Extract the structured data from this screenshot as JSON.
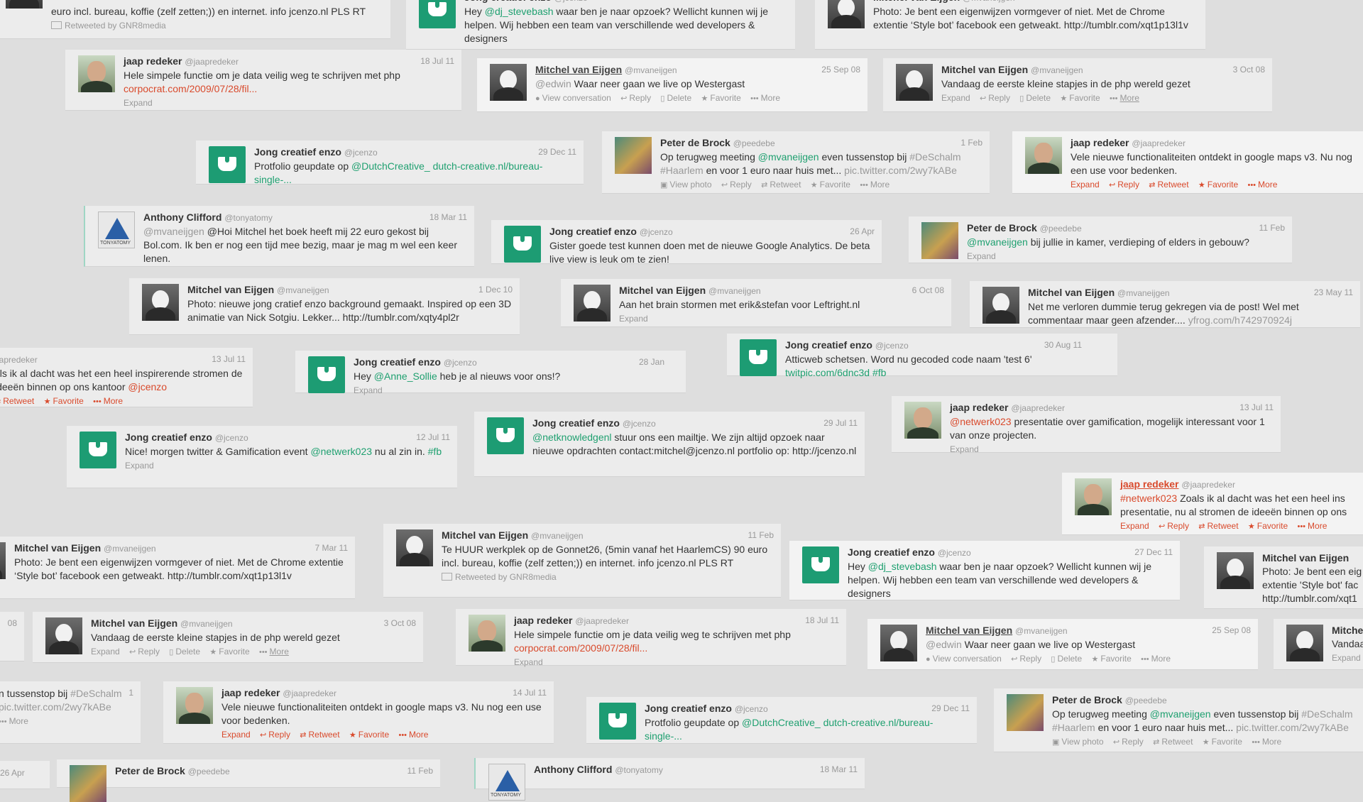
{
  "screen": {
    "background": "#dedede",
    "card_background": "#ececec",
    "accent_green": "#1fa070",
    "accent_red": "#d94a2c"
  },
  "users": {
    "jcenzo": {
      "name": "Jong creatief enzo",
      "handle": "@jcenzo"
    },
    "mvaneijgen": {
      "name": "Mitchel van Eijgen",
      "handle": "@mvaneijgen"
    },
    "jaapredeker": {
      "name": "jaap redeker",
      "handle": "@jaapredeker"
    },
    "peedebe": {
      "name": "Peter de Brock",
      "handle": "@peedebe"
    },
    "tonyatomy": {
      "name": "Anthony Clifford",
      "handle": "@tonyatomy"
    }
  },
  "labels": {
    "expand": "Expand",
    "reply": "Reply",
    "retweet": "Retweet",
    "favorite": "Favorite",
    "more": "More",
    "delete": "Delete",
    "view_photo": "View photo",
    "view_conversation": "View conversation",
    "retweeted_by": "Retweeted by GNR8media"
  },
  "text": {
    "werkplek": "Te HUUR werkplek op de Gonnet26, (5min vanaf het HaarlemCS) 90 euro incl. bureau, koffie (zelf zetten;)) en internet. info jcenzo.nl PLS RT",
    "werkplek_tail": "euro incl. bureau, koffie (zelf zetten;)) en internet. info jcenzo.nl PLS RT",
    "hey_pre": "Hey ",
    "stevebash": "@dj_stevebash",
    "hey_post": " waar ben je naar opzoek? Wellicht kunnen wij je helpen. Wij hebben een team van verschillende wed developers & designers",
    "photo_style": "Photo: Je bent een eigenwijzen vormgever of niet. Met de Chrome extentie ‘Style bot’ facebook een getweakt. http://tumblr.com/xqt1p13l1v",
    "php_func": "Hele simpele functie om je data veilig weg te schrijven met php ",
    "php_url": "corpocrat.com/2009/07/28/fil...",
    "edwin_mention": "@edwin",
    "edwin_post": " Waar neer gaan we live op Westergast",
    "php_steps": "Vandaag de eerste kleine stapjes in de php wereld gezet",
    "portfolio_pre": "Protfolio geupdate op ",
    "portfolio_mention": "@DutchCreative_ dutch-creative.nl/bureau-single-...",
    "meeting_pre": "Op terugweg meeting ",
    "meeting_mention": "@mvaneijgen",
    "meeting_mid": " even tussenstop bij ",
    "meeting_tag": "#DeSchalm #Haarlem",
    "meeting_post": " en voor 1 euro naar huis met... ",
    "meeting_pic": "pic.twitter.com/2wy7kABe",
    "maps": "Vele nieuwe functionaliteiten ontdekt in google maps v3. Nu nog een use voor bedenken.",
    "boek_mention": "@mvaneijgen",
    "boek_mid": " @Hoi Mitchel het boek heeft mij 22 euro gekost bij Bol.com. Ik ben er nog een tijd mee bezig, maar je mag m wel een keer lenen.",
    "analytics": "Gister goede test kunnen doen met de nieuwe Google Analytics. De beta live view is leuk om te zien!",
    "kamer_mention": "@mvaneijgen",
    "kamer_post": " bij jullie in kamer, verdieping of elders in gebouw?",
    "background_photo": "Photo: nieuwe jong cratief enzo background gemaakt. Inspired op een 3D animatie van Nick Sotgiu. Lekker... http://tumblr.com/xqty4pl2r",
    "brainstorm": "Aan het brain stormen met erik&stefan voor Leftright.nl",
    "dummie_pre": "Net me verloren dummie terug gekregen via de post! Wel met commentaar maar geen afzender.... ",
    "dummie_url": "yfrog.com/h742970924j",
    "atticweb": "Atticweb schetsen. Word nu gecoded code naam 'test 6' ",
    "atticweb_link": "twitpic.com/6dnc3d #fb",
    "inspirerend_pre": "Zoals ik al dacht was het een heel inspirerende presentatie, nu al stromen de ideeën binnen op ons kantoor ",
    "inspirerend_short_pre": "als ik al dacht was het een heel inspirerende stromen de ideeën binnen op ons kantoor ",
    "inspirerend_mention": "@jcenzo",
    "sollie_pre": "Hey ",
    "sollie_mention": "@Anne_Sollie",
    "sollie_post": " heb je al nieuws voor ons!?",
    "mailtje_mention": "@netknowledgenl",
    "mailtje_post": " stuur ons een mailtje. We zijn altijd opzoek naar nieuwe opdrachten contact:mitchel@jcenzo.nl portfolio op: http://jcenzo.nl",
    "gamification_mention": "@netwerk023",
    "gamification_post": " presentatie over gamification, mogelijk interessant voor 1 van onze projecten.",
    "nice_pre": "Nice! morgen twitter & Gamification event ",
    "nice_mention": "@netwerk023",
    "nice_mid": " nu al zin in. ",
    "nice_tag": "#fb",
    "netwerk_mention": "#netwerk023",
    "inspirerend_frag": "Zoals ik al dacht was het een heel ins presentatie, nu al stromen de ideeën binnen op ons",
    "photo_style_frag": "Photo: Je bent een eig extentie 'Style bot' fac http://tumblr.com/xqt1",
    "vandaag_frag": "Vandaag",
    "tussenstop_frag": "n tussenstop bij ",
    "tussenstop_tag": "#DeSchalm",
    "tussenstop_pic": "pic.twitter.com/2wy7kABe"
  },
  "dates": {
    "d27dec11": "27 Dec 11",
    "d7mar11": "7 Mar 11",
    "d18jul11": "18 Jul 11",
    "d25sep08": "25 Sep 08",
    "d3oct08": "3 Oct 08",
    "d29dec11": "29 Dec 11",
    "d1feb": "1 Feb",
    "d18mar11": "18 Mar 11",
    "d26apr": "26 Apr",
    "d11feb": "11 Feb",
    "d1dec10": "1 Dec 10",
    "d6oct08": "6 Oct 08",
    "d23may11": "23 May 11",
    "d30aug11": "30 Aug 11",
    "d13jul11": "13 Jul 11",
    "d28jan": "28 Jan",
    "d12jul11": "12 Jul 11",
    "d29jul11": "29 Jul 11",
    "d14jul11": "14 Jul 11",
    "d08": "08",
    "d26apr_frag": "26 Apr",
    "d1_frag": "1"
  },
  "fragments": {
    "jaapredeker_frag": "aapredeker"
  }
}
